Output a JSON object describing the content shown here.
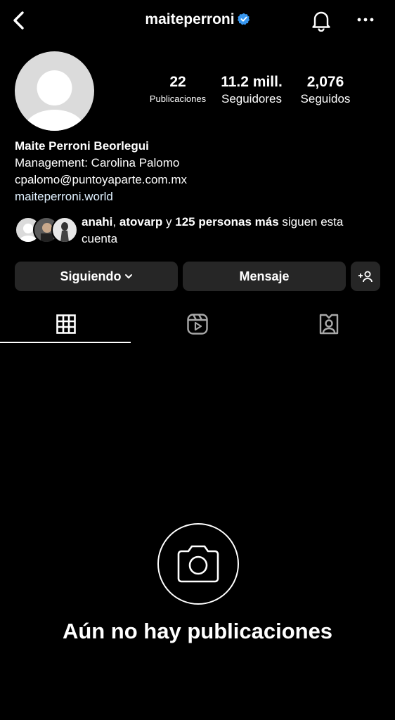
{
  "header": {
    "username": "maiteperroni",
    "back_icon": "chevron-left-icon",
    "verified_icon": "verified-badge-icon",
    "verified_color": "#3897f0",
    "bell_icon": "bell-icon",
    "more_icon": "more-horizontal-icon"
  },
  "stats": {
    "posts_count": "22",
    "posts_label": "Publicaciones",
    "followers_count": "11.2 mill.",
    "followers_label": "Seguidores",
    "following_count": "2,076",
    "following_label": "Seguidos"
  },
  "bio": {
    "name": "Maite Perroni Beorlegui",
    "line1": "Management: Carolina Palomo",
    "line2": "cpalomo@puntoyaparte.com.mx",
    "link": "maiteperroni.world"
  },
  "mutual": {
    "user1": "anahi",
    "sep1": ", ",
    "user2": "atovarp",
    "sep2": " y ",
    "others": "125 personas más",
    "suffix": " siguen esta cuenta"
  },
  "actions": {
    "following_label": "Siguiendo",
    "message_label": "Mensaje",
    "add_user_icon": "add-person-icon"
  },
  "tabs": [
    {
      "icon": "grid-icon",
      "active": true
    },
    {
      "icon": "reels-icon",
      "active": false
    },
    {
      "icon": "tagged-icon",
      "active": false
    }
  ],
  "empty_state": {
    "icon": "camera-icon",
    "text": "Aún no hay publicaciones"
  }
}
